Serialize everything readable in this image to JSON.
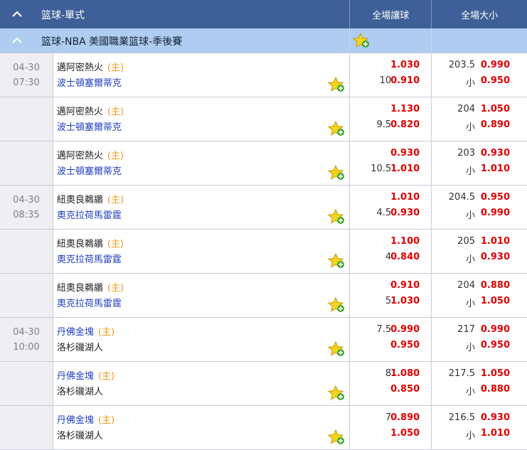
{
  "header": {
    "sport_title": "篮球-單式",
    "col_handicap": "全場讓球",
    "col_total": "全場大小"
  },
  "league": {
    "name": "篮球-NBA 美國職業篮球-季後賽"
  },
  "rows": [
    {
      "date": "04-30",
      "time": "07:30",
      "team_a": "邁阿密熱火",
      "team_b": "波士頓塞爾蒂克",
      "home_label": "(主)",
      "hc_a_line": "",
      "hc_a_odds": "1.030",
      "hc_b_line": "10",
      "hc_b_odds": "0.910",
      "tot_a_line": "203.5",
      "tot_a_odds": "0.990",
      "tot_b_line": "小",
      "tot_b_odds": "0.950",
      "a_blue": false
    },
    {
      "date": "",
      "time": "",
      "team_a": "邁阿密熱火",
      "team_b": "波士頓塞爾蒂克",
      "home_label": "(主)",
      "hc_a_line": "",
      "hc_a_odds": "1.130",
      "hc_b_line": "9.5",
      "hc_b_odds": "0.820",
      "tot_a_line": "204",
      "tot_a_odds": "1.050",
      "tot_b_line": "小",
      "tot_b_odds": "0.890",
      "a_blue": false
    },
    {
      "date": "",
      "time": "",
      "team_a": "邁阿密熱火",
      "team_b": "波士頓塞爾蒂克",
      "home_label": "(主)",
      "hc_a_line": "",
      "hc_a_odds": "0.930",
      "hc_b_line": "10.5",
      "hc_b_odds": "1.010",
      "tot_a_line": "203",
      "tot_a_odds": "0.930",
      "tot_b_line": "小",
      "tot_b_odds": "1.010",
      "a_blue": false
    },
    {
      "date": "04-30",
      "time": "08:35",
      "team_a": "紐奧良鵜鶘",
      "team_b": "奧克拉荷馬雷霆",
      "home_label": "(主)",
      "hc_a_line": "",
      "hc_a_odds": "1.010",
      "hc_b_line": "4.5",
      "hc_b_odds": "0.930",
      "tot_a_line": "204.5",
      "tot_a_odds": "0.950",
      "tot_b_line": "小",
      "tot_b_odds": "0.990",
      "a_blue": false
    },
    {
      "date": "",
      "time": "",
      "team_a": "紐奧良鵜鶘",
      "team_b": "奧克拉荷馬雷霆",
      "home_label": "(主)",
      "hc_a_line": "",
      "hc_a_odds": "1.100",
      "hc_b_line": "4",
      "hc_b_odds": "0.840",
      "tot_a_line": "205",
      "tot_a_odds": "1.010",
      "tot_b_line": "小",
      "tot_b_odds": "0.930",
      "a_blue": false
    },
    {
      "date": "",
      "time": "",
      "team_a": "紐奧良鵜鶘",
      "team_b": "奧克拉荷馬雷霆",
      "home_label": "(主)",
      "hc_a_line": "",
      "hc_a_odds": "0.910",
      "hc_b_line": "5",
      "hc_b_odds": "1.030",
      "tot_a_line": "204",
      "tot_a_odds": "0.880",
      "tot_b_line": "小",
      "tot_b_odds": "1.050",
      "a_blue": false
    },
    {
      "date": "04-30",
      "time": "10:00",
      "team_a": "丹佛金塊",
      "team_b": "洛杉磯湖人",
      "home_label": "(主)",
      "hc_a_line": "7.5",
      "hc_a_odds": "0.990",
      "hc_b_line": "",
      "hc_b_odds": "0.950",
      "tot_a_line": "217",
      "tot_a_odds": "0.990",
      "tot_b_line": "小",
      "tot_b_odds": "0.950",
      "a_blue": true
    },
    {
      "date": "",
      "time": "",
      "team_a": "丹佛金塊",
      "team_b": "洛杉磯湖人",
      "home_label": "(主)",
      "hc_a_line": "8",
      "hc_a_odds": "1.080",
      "hc_b_line": "",
      "hc_b_odds": "0.850",
      "tot_a_line": "217.5",
      "tot_a_odds": "1.050",
      "tot_b_line": "小",
      "tot_b_odds": "0.880",
      "a_blue": true
    },
    {
      "date": "",
      "time": "",
      "team_a": "丹佛金塊",
      "team_b": "洛杉磯湖人",
      "home_label": "(主)",
      "hc_a_line": "7",
      "hc_a_odds": "0.890",
      "hc_b_line": "",
      "hc_b_odds": "1.050",
      "tot_a_line": "216.5",
      "tot_a_odds": "0.930",
      "tot_b_line": "小",
      "tot_b_odds": "1.010",
      "a_blue": true
    }
  ],
  "colors": {
    "header_bg": "#3e5f97",
    "league_bg": "#aecdf0",
    "odds": "#e00000",
    "home": "#f09a1a",
    "team_blue": "#1f3fbf"
  },
  "icons": {
    "collapse": "chevron-up-icon",
    "favorite": "star-plus-icon"
  }
}
